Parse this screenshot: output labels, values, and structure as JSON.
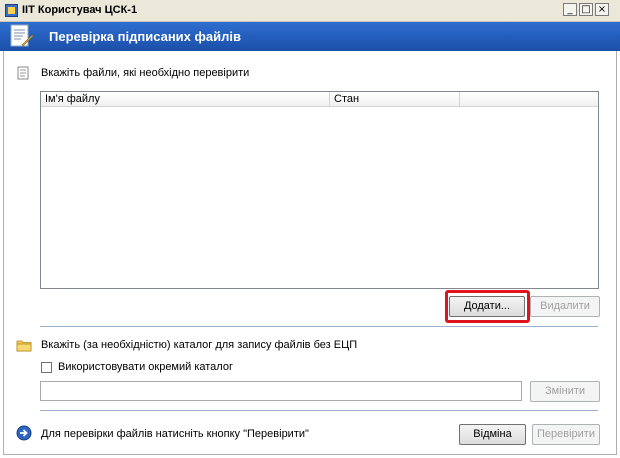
{
  "window": {
    "title": "ІІТ Користувач ЦСК-1",
    "minimize_glyph": "_",
    "maximize_glyph": "□",
    "close_glyph": "×"
  },
  "header": {
    "title": "Перевірка підписаних файлів",
    "icon": "document-sign-icon"
  },
  "files_section": {
    "label": "Вкажіть файли, які необхідно перевірити",
    "columns": [
      "Ім'я файлу",
      "Стан"
    ],
    "rows": [],
    "add_button": "Додати...",
    "delete_button": "Видалити"
  },
  "catalog_section": {
    "label": "Вкажіть (за необхідністю) каталог для запису файлів без ЕЦП",
    "checkbox_label": "Використовувати окремий каталог",
    "checkbox_checked": false,
    "path_value": "",
    "change_button": "Змінити"
  },
  "footer": {
    "hint": "Для перевірки файлів натисніть кнопку \"Перевірити\"",
    "cancel_button": "Відміна",
    "verify_button": "Перевірити"
  },
  "colors": {
    "header_bg": "#2463c2",
    "highlight": "#e0141e"
  }
}
